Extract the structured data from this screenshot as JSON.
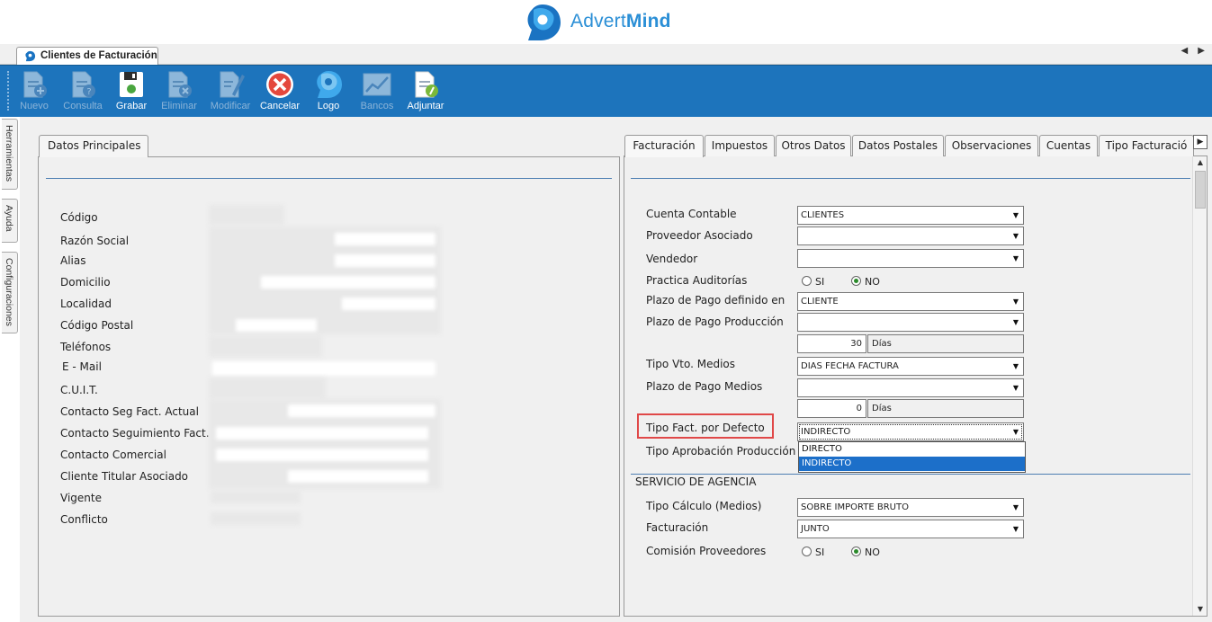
{
  "brand": {
    "name_regular": "Advert",
    "name_bold": "Mind",
    "color": "#2b8fd6"
  },
  "doc_tab": {
    "title": "Clientes de Facturación",
    "nav": "◀ ▶"
  },
  "toolbar": {
    "background": "#1d74bc",
    "buttons": [
      {
        "label": "Nuevo",
        "icon": "new-doc-icon",
        "enabled": false
      },
      {
        "label": "Consulta",
        "icon": "query-doc-icon",
        "enabled": false
      },
      {
        "label": "Grabar",
        "icon": "save-icon",
        "enabled": true
      },
      {
        "label": "Eliminar",
        "icon": "delete-doc-icon",
        "enabled": false
      },
      {
        "label": "Modificar",
        "icon": "edit-doc-icon",
        "enabled": false
      },
      {
        "label": "Cancelar",
        "icon": "cancel-icon",
        "enabled": true
      },
      {
        "label": "Logo",
        "icon": "logo-icon",
        "enabled": true
      },
      {
        "label": "Bancos",
        "icon": "chart-icon",
        "enabled": false
      },
      {
        "label": "Adjuntar",
        "icon": "attach-doc-icon",
        "enabled": true
      }
    ]
  },
  "side_tabs": [
    "Herramientas",
    "Ayuda",
    "Configuraciones"
  ],
  "left": {
    "tab": "Datos Principales",
    "labels": [
      "Código",
      "Razón Social",
      "Alias",
      "Domicilio",
      "Localidad",
      "Código Postal",
      "Teléfonos",
      "E - Mail",
      "C.U.I.T.",
      "Contacto Seg Fact. Actual",
      "Contacto Seguimiento Fact.",
      "Contacto Comercial",
      "Cliente Titular Asociado",
      "Vigente",
      "Conflicto"
    ]
  },
  "right": {
    "tabs": [
      "Facturación",
      "Impuestos",
      "Otros Datos",
      "Datos Postales",
      "Observaciones",
      "Cuentas",
      "Tipo Facturació"
    ],
    "active_tab": "Facturación",
    "fields": {
      "cuenta_contable": {
        "label": "Cuenta Contable",
        "value": "CLIENTES"
      },
      "proveedor_asociado": {
        "label": "Proveedor Asociado",
        "value": ""
      },
      "vendedor": {
        "label": "Vendedor",
        "value": ""
      },
      "practica_auditorias": {
        "label": "Practica Auditorías",
        "opt_si": "SI",
        "opt_no": "NO",
        "selected": "NO"
      },
      "plazo_pago_definido": {
        "label": "Plazo de Pago definido en",
        "value": "CLIENTE"
      },
      "plazo_pago_produccion": {
        "label": "Plazo de Pago Producción",
        "value": "",
        "days": "30",
        "unit": "Días"
      },
      "tipo_vto_medios": {
        "label": "Tipo Vto. Medios",
        "value": "DIAS FECHA FACTURA"
      },
      "plazo_pago_medios": {
        "label": "Plazo de Pago Medios",
        "value": "",
        "days": "0",
        "unit": "Días"
      },
      "tipo_fact_defecto": {
        "label": "Tipo Fact. por Defecto",
        "value": "INDIRECTO",
        "options": [
          "DIRECTO",
          "INDIRECTO"
        ],
        "selected_option": "INDIRECTO"
      },
      "tipo_aprobacion_produccion": {
        "label": "Tipo Aprobación Producción"
      }
    },
    "section_agencia": {
      "title": "SERVICIO DE AGENCIA",
      "tipo_calculo": {
        "label": "Tipo Cálculo (Medios)",
        "value": "SOBRE IMPORTE BRUTO"
      },
      "facturacion": {
        "label": "Facturación",
        "value": "JUNTO"
      },
      "comision_proveedores": {
        "label": "Comisión Proveedores",
        "opt_si": "SI",
        "opt_no": "NO",
        "selected": "NO"
      }
    }
  },
  "colors": {
    "highlight": "#e04848",
    "selection": "#1c6fc9"
  }
}
